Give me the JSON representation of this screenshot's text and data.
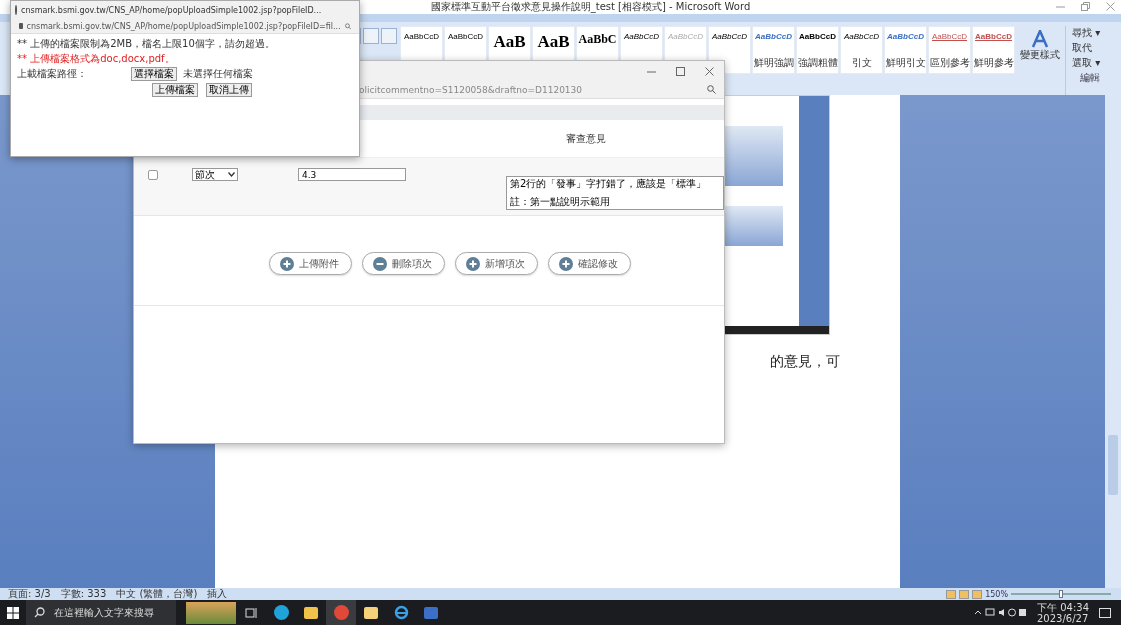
{
  "word": {
    "title": "國家標準互動平台徵求意見操作說明_test [相容模式] - Microsoft Word",
    "styles": [
      {
        "sample": "AaBbCcD",
        "kind": "normal"
      },
      {
        "sample": "AaBbCcD",
        "kind": "normal"
      },
      {
        "sample": "AaB",
        "kind": "heading"
      },
      {
        "sample": "AaB",
        "kind": "heading"
      },
      {
        "sample": "AaBbC",
        "kind": "heading2"
      },
      {
        "sample": "AaBbCcD",
        "kind": "italic"
      },
      {
        "sample": "AaBbCcD",
        "kind": "faint"
      },
      {
        "sample": "AaBbCcD",
        "kind": "italic"
      },
      {
        "sample": "AaBbCcD",
        "kind": "accent",
        "label": "鮮明強調"
      },
      {
        "sample": "AaBbCcD",
        "kind": "bold",
        "label": "強調粗體"
      },
      {
        "sample": "AaBbCcD",
        "kind": "italic",
        "label": "引文"
      },
      {
        "sample": "AaBbCcD",
        "kind": "accent",
        "label": "鮮明引文"
      },
      {
        "sample": "AaBbCcD",
        "kind": "red",
        "label": "區別參考"
      },
      {
        "sample": "AaBbCcD",
        "kind": "redbold",
        "label": "鮮明參考"
      }
    ],
    "change_styles": "變更樣式",
    "editing": [
      "尋找 ▾",
      "取代",
      "選取 ▾"
    ],
    "editing_group": "編輯",
    "document_text": "的意見，可",
    "status_bar": [
      "頁面: 3/3",
      "字數: 333",
      "中文 (繁體，台灣)",
      "插入"
    ],
    "zoom": "150%",
    "zoom_slider": {
      "level": 0.5
    }
  },
  "review_window": {
    "address": "olicitcommentno=S1120058&draftno=D1120130",
    "column_header": "審查意見",
    "row": {
      "checked": false,
      "section": "節次",
      "number": "4.3",
      "comment_lines": [
        "第2行的「發事」字打錯了，應該是「標準」",
        "註：第一點說明示範用"
      ]
    },
    "buttons": [
      {
        "label": "上傳附件",
        "kind": "add"
      },
      {
        "label": "刪除項次",
        "kind": "remove"
      },
      {
        "label": "新增項次",
        "kind": "add"
      },
      {
        "label": "確認修改",
        "kind": "add"
      }
    ]
  },
  "upload_popup": {
    "title": "cnsmark.bsmi.gov.tw/CNS_AP/home/popUploadSimple1002.jsp?popFileID...",
    "address": "cnsmark.bsmi.gov.tw/CNS_AP/home/popUploadSimple1002.jsp?popFileID=fil...",
    "notes": [
      {
        "text": "** 上傳的檔案限制為2MB，檔名上限10個字，請勿超過。",
        "kind": "plain"
      },
      {
        "text": "** 上傳檔案格式為doc,docx,pdf。",
        "kind": "warning"
      }
    ],
    "path_label": "上載檔案路徑：",
    "choose_button": "選擇檔案",
    "no_file": "未選擇任何檔案",
    "actions": [
      "上傳檔案",
      "取消上傳"
    ]
  },
  "taskbar": {
    "search_placeholder": "在這裡輸入文字來搜尋",
    "time": "下午 04:34",
    "date": "2023/6/27"
  }
}
